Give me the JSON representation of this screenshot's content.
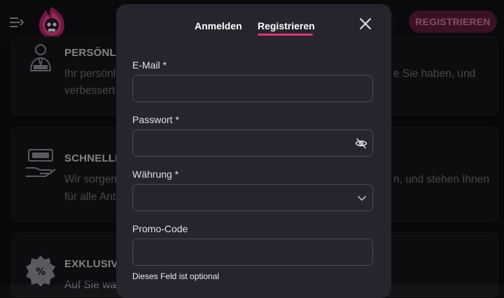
{
  "header": {
    "register_button": "REGISTRIEREN"
  },
  "cards": [
    {
      "title": "PERSÖNLI",
      "line1": "Ihr persönli",
      "line1_right": "e Sie haben, und",
      "line2": "verbessert"
    },
    {
      "title": "SCHNELLI",
      "line1": "Wir sorgen",
      "line1_right": "n, und stehen Ihnen",
      "line2": "für alle Ant"
    },
    {
      "title": "EXKLUSIV",
      "line1": "Auf Sie wart",
      "line1_right": ""
    }
  ],
  "modal": {
    "tabs": [
      {
        "label": "Anmelden",
        "active": false
      },
      {
        "label": "Registrieren",
        "active": true
      }
    ],
    "fields": {
      "email_label": "E-Mail *",
      "password_label": "Passwort *",
      "currency_label": "Währung *",
      "promo_label": "Promo-Code"
    },
    "promo_hint": "Dieses Feld ist optional"
  },
  "colors": {
    "accent": "#e0336f",
    "modal_bg": "#26252d",
    "page_bg": "#0d0d10"
  },
  "icons": [
    "menu-collapse-icon",
    "skull-flame-logo",
    "close-icon",
    "eye-off-icon",
    "chevron-down-icon",
    "advisor-icon",
    "cash-hand-icon",
    "percent-badge-icon"
  ]
}
